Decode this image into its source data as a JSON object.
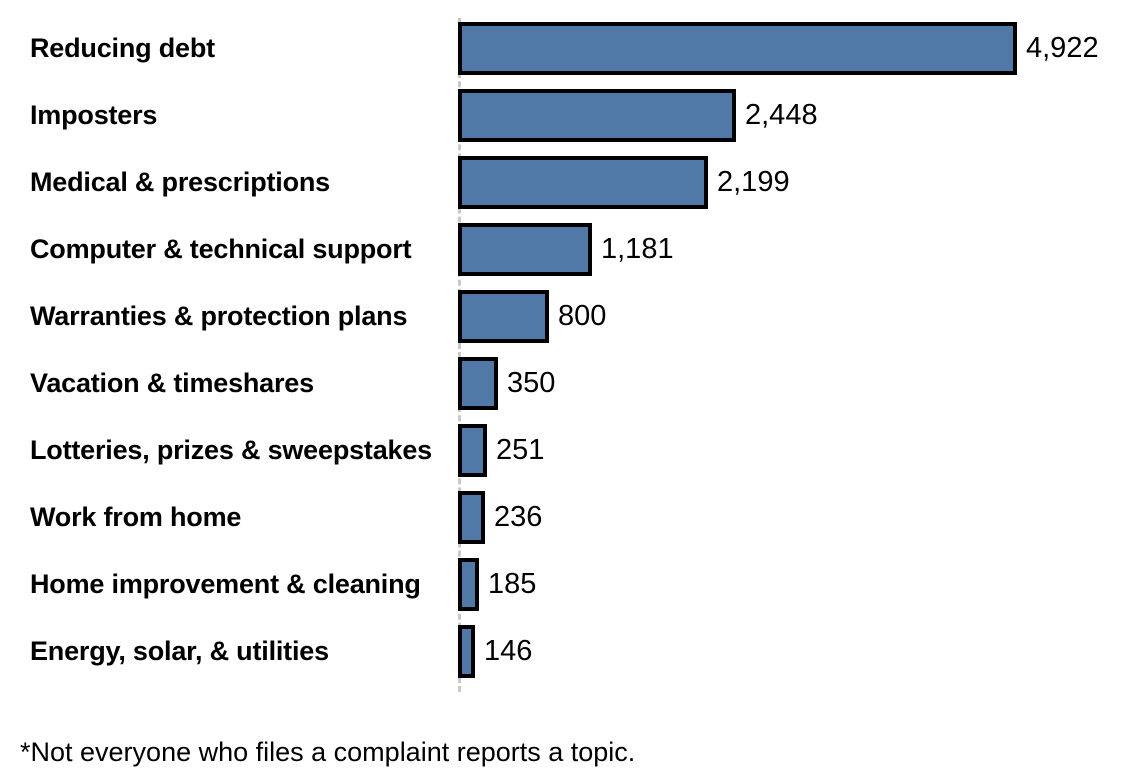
{
  "chart_data": {
    "type": "bar",
    "orientation": "horizontal",
    "title": "",
    "subtitle": "",
    "xlabel": "",
    "ylabel": "",
    "grid": false,
    "legend": null,
    "legend_position": "none",
    "xlim": [
      0,
      4922
    ],
    "bar_color": "#5179A7",
    "bar_border_color": "#000000",
    "baseline_color": "#C9C9C9",
    "text_color": "#000000",
    "background": "#FFFFFF",
    "categories": [
      "Reducing debt",
      "Imposters",
      "Medical & prescriptions",
      "Computer & technical support",
      "Warranties & protection plans",
      "Vacation & timeshares",
      "Lotteries, prizes & sweepstakes",
      "Work from home",
      "Home improvement & cleaning",
      "Energy, solar, & utilities"
    ],
    "values": [
      4922,
      2448,
      2199,
      1181,
      800,
      350,
      251,
      236,
      185,
      146
    ],
    "value_labels": [
      "4,922",
      "2,448",
      "2,199",
      "1,181",
      "800",
      "350",
      "251",
      "236",
      "185",
      "146"
    ],
    "annotations": [
      "*Not everyone who files a complaint reports a topic."
    ]
  },
  "footnote": {
    "text": "*Not everyone who files a complaint reports a topic."
  }
}
